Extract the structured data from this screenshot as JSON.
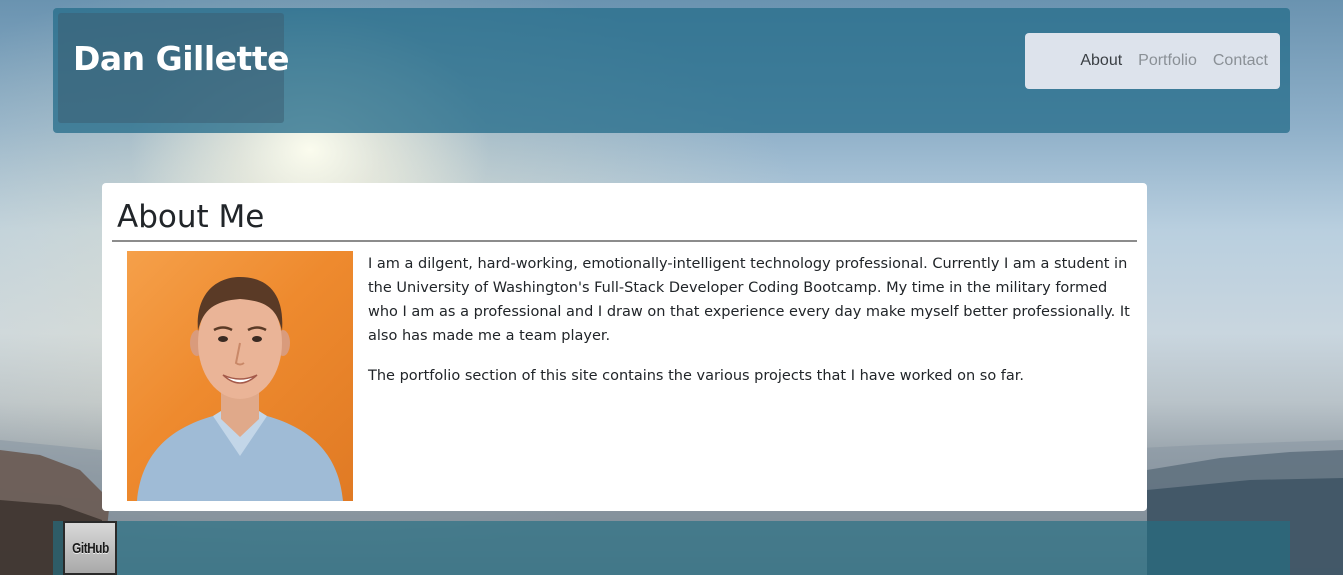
{
  "header": {
    "brand": "Dan Gillette",
    "nav": [
      {
        "label": "About",
        "active": true
      },
      {
        "label": "Portfolio",
        "active": false
      },
      {
        "label": "Contact",
        "active": false
      }
    ]
  },
  "about": {
    "title": "About Me",
    "paragraphs": [
      "I am a dilgent, hard-working, emotionally-intelligent technology professional. Currently I am a student in the University of Washington's Full-Stack Developer Coding Bootcamp. My time in the military formed who I am as a professional and I draw on that experience every day make myself better professionally. It also has made me a team player.",
      "The portfolio section of this site contains the various projects that I have worked on so far."
    ]
  },
  "footer": {
    "github_label": "GitHub"
  },
  "colors": {
    "header_bg": "#2d6e8c",
    "nav_bg": "#dde3ec",
    "photo_bg": "#ee8a2e"
  }
}
